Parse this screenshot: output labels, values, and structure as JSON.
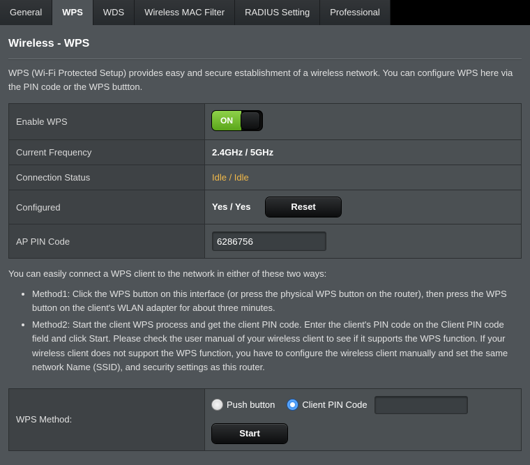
{
  "tabs": {
    "general": "General",
    "wps": "WPS",
    "wds": "WDS",
    "mac": "Wireless MAC Filter",
    "radius": "RADIUS Setting",
    "pro": "Professional"
  },
  "title": "Wireless - WPS",
  "description": "WPS (Wi-Fi Protected Setup) provides easy and secure establishment of a wireless network. You can configure WPS here via the PIN code or the WPS buttton.",
  "rows": {
    "enable_label": "Enable WPS",
    "toggle_on_text": "ON",
    "freq_label": "Current Frequency",
    "freq_value": "2.4GHz / 5GHz",
    "conn_label": "Connection Status",
    "conn_value": "Idle / Idle",
    "cfg_label": "Configured",
    "cfg_value": "Yes / Yes",
    "reset_btn": "Reset",
    "appin_label": "AP PIN Code",
    "appin_value": "6286756"
  },
  "methods_intro": "You can easily connect a WPS client to the network in either of these two ways:",
  "methods": {
    "m1": "Method1: Click the WPS button on this interface (or press the physical WPS button on the router), then press the WPS button on the client's WLAN adapter for about three minutes.",
    "m2": "Method2: Start the client WPS process and get the client PIN code. Enter the client's PIN code on the Client PIN code field and click Start. Please check the user manual of your wireless client to see if it supports the WPS function. If your wireless client does not support the WPS function, you have to configure the wireless client manually and set the same network Name (SSID), and security settings as this router."
  },
  "method_row": {
    "label": "WPS Method:",
    "opt_push": "Push button",
    "opt_pin": "Client PIN Code",
    "pin_value": "",
    "start_btn": "Start"
  }
}
